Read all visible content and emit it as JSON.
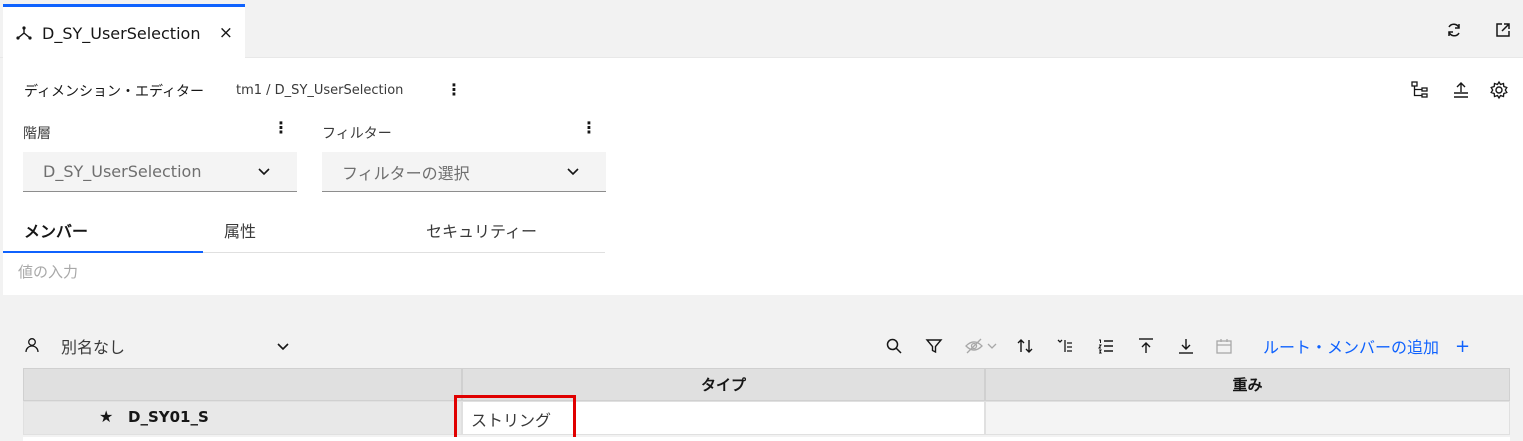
{
  "tab": {
    "title": "D_SY_UserSelection",
    "close": "×"
  },
  "editor": {
    "title": "ディメンション・エディター",
    "path": "tm1 / D_SY_UserSelection",
    "menu": "⋮"
  },
  "hierarchy": {
    "label": "階層",
    "value": "D_SY_UserSelection"
  },
  "filter": {
    "label": "フィルター",
    "placeholder": "フィルターの選択"
  },
  "tabs": [
    {
      "label": "メンバー",
      "active": true
    },
    {
      "label": "属性",
      "active": false
    },
    {
      "label": "セキュリティー",
      "active": false
    }
  ],
  "value_input": {
    "placeholder": "値の入力"
  },
  "alias": {
    "value": "別名なし"
  },
  "toolbar": {
    "add_root_label": "ルート・メンバーの追加",
    "add_plus": "+"
  },
  "grid": {
    "columns": [
      "",
      "タイプ",
      "重み"
    ],
    "rows": [
      {
        "star": "★",
        "name": "D_SY01_S",
        "type": "ストリング",
        "weight": ""
      }
    ]
  },
  "colors": {
    "accent": "#0f62fe",
    "highlight_box": "#e00000"
  }
}
